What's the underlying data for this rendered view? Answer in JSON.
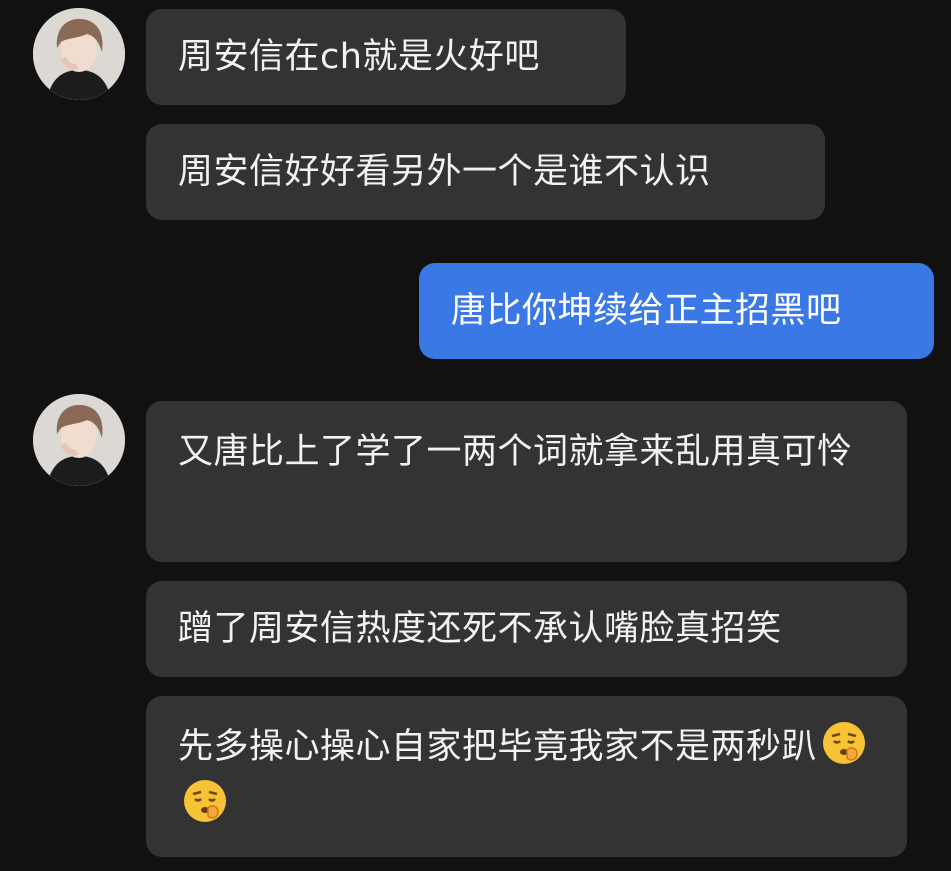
{
  "conversation": {
    "messages": [
      {
        "side": "incoming",
        "text": "周安信在ch就是火好吧"
      },
      {
        "side": "incoming",
        "text": "周安信好好看另外一个是谁不认识"
      },
      {
        "side": "outgoing",
        "text": "唐比你坤续给正主招黑吧"
      },
      {
        "side": "incoming",
        "text": "又唐比上了学了一两个词就拿来乱用真可怜"
      },
      {
        "side": "incoming",
        "text": "蹭了周安信热度还死不承认嘴脸真招笑"
      },
      {
        "side": "incoming",
        "text": "先多操心操心自家把毕竟我家不是两秒趴",
        "emojis": [
          "pouting-shush-face-icon",
          "pouting-shush-face-icon"
        ]
      }
    ]
  },
  "colors": {
    "background": "#111111",
    "incoming_bubble": "#333333",
    "outgoing_bubble": "#3a78e6",
    "text": "#f2f2f2"
  }
}
